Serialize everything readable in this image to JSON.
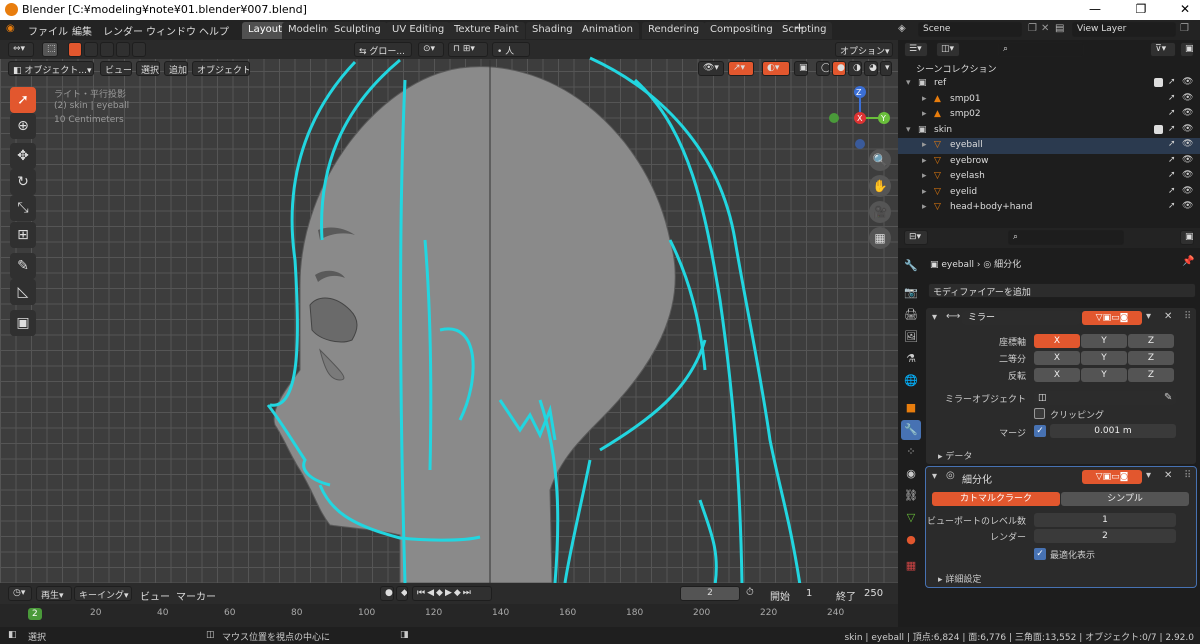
{
  "title": "Blender [C:¥modeling¥note¥01.blender¥007.blend]",
  "menu": {
    "file": "ファイル",
    "edit": "編集",
    "render": "レンダー",
    "window": "ウィンドウ",
    "help": "ヘルプ"
  },
  "workspaces": [
    "Layout",
    "Modeling",
    "Sculpting",
    "UV Editing",
    "Texture Paint",
    "Shading",
    "Animation",
    "Rendering",
    "Compositing",
    "Scripting"
  ],
  "scene": "Scene",
  "view_layer": "View Layer",
  "viewport": {
    "mode": "オブジェクト...",
    "view": "ビュー",
    "select": "選択",
    "add": "追加",
    "object": "オブジェクト",
    "transform": "グロー...",
    "options": "オプション",
    "ov1": "ライト・平行投影",
    "ov2": "(2) skin | eyeball",
    "ov3": "10 Centimeters",
    "axis_x": "X",
    "axis_y": "Y",
    "axis_z": "Z"
  },
  "outliner": {
    "title": "シーンコレクション",
    "items": [
      {
        "name": "ref",
        "level": 0,
        "icon": "collection"
      },
      {
        "name": "smp01",
        "level": 1,
        "icon": "image"
      },
      {
        "name": "smp02",
        "level": 1,
        "icon": "image"
      },
      {
        "name": "skin",
        "level": 0,
        "icon": "collection"
      },
      {
        "name": "eyeball",
        "level": 1,
        "icon": "mesh"
      },
      {
        "name": "eyebrow",
        "level": 1,
        "icon": "mesh"
      },
      {
        "name": "eyelash",
        "level": 1,
        "icon": "mesh"
      },
      {
        "name": "eyelid",
        "level": 1,
        "icon": "mesh"
      },
      {
        "name": "head+body+hand",
        "level": 1,
        "icon": "mesh"
      }
    ]
  },
  "props": {
    "object": "eyeball",
    "modifier_icon_label": "細分化",
    "add_modifier": "モディファイアーを追加",
    "mirror": {
      "name": "ミラー",
      "axis": "座標軸",
      "bisect": "二等分",
      "flip": "反転",
      "x": "X",
      "y": "Y",
      "z": "Z",
      "mirror_object": "ミラーオブジェクト",
      "clipping": "クリッピング",
      "merge": "マージ",
      "merge_val": "0.001 m",
      "data": "データ"
    },
    "subsurf": {
      "name": "細分化",
      "catmull": "カトマルクラーク",
      "simple": "シンプル",
      "viewport_levels": "ビューポートのレベル数",
      "viewport_val": "1",
      "render": "レンダー",
      "render_val": "2",
      "optimal": "最適化表示",
      "advanced": "詳細設定"
    }
  },
  "timeline": {
    "playback": "再生",
    "keying": "キーイング",
    "view": "ビュー",
    "marker": "マーカー",
    "frame": "2",
    "start_label": "開始",
    "start": "1",
    "end_label": "終了",
    "end": "250",
    "ticks": [
      "2",
      "20",
      "40",
      "60",
      "80",
      "100",
      "120",
      "140",
      "160",
      "180",
      "200",
      "220",
      "240"
    ]
  },
  "status": {
    "select": "選択",
    "center": "マウス位置を視点の中心に",
    "stats": "skin | eyeball | 頂点:6,824 | 面:6,776 | 三角面:13,552 | オブジェクト:0/7 | 2.92.0"
  }
}
